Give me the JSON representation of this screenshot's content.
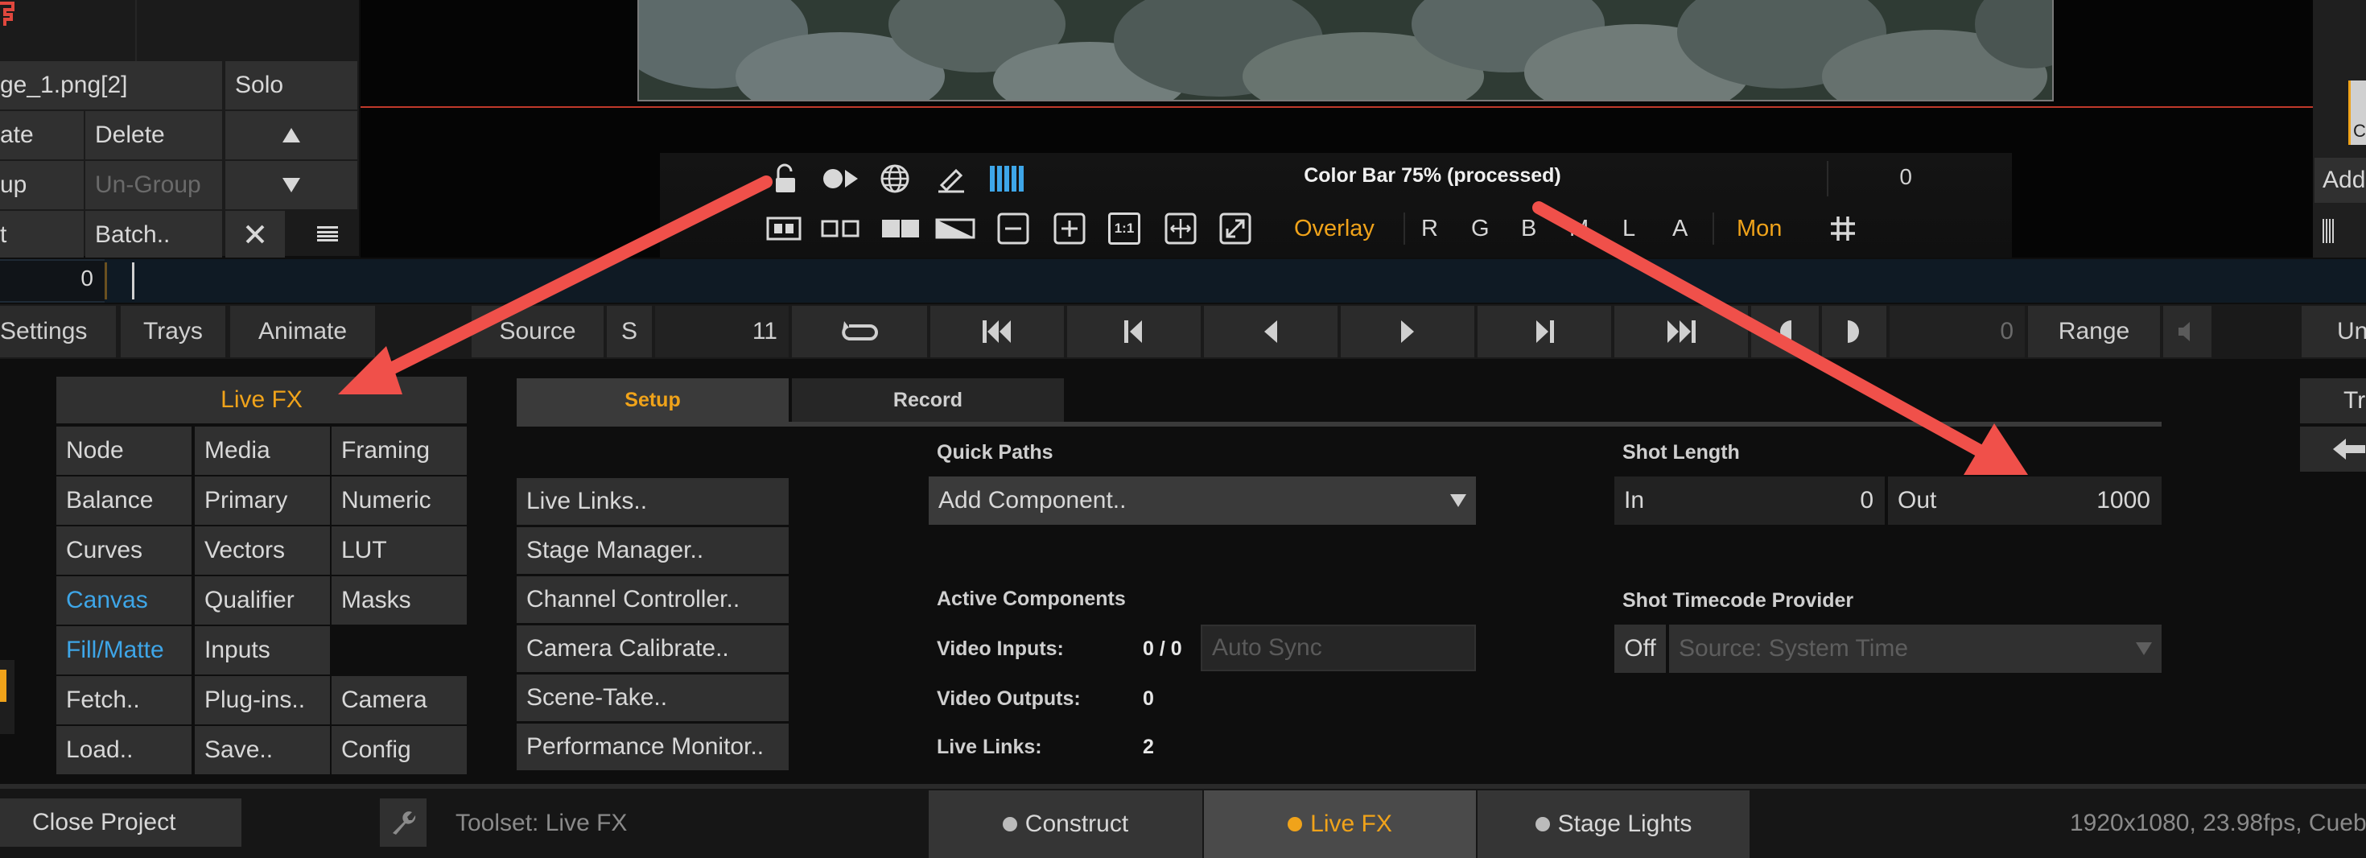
{
  "layer_panel": {
    "layer_name": "ge_1.png[2]",
    "solo_label": "Solo",
    "duplicate_label": "ate",
    "delete_label": "Delete",
    "group_label": "up",
    "ungroup_label": "Un-Group",
    "edit_label": "t",
    "batch_label": "Batch.."
  },
  "viewer_toolbar": {
    "status_text": "Color Bar 75% (processed)",
    "frame_value": "0",
    "overlay_label": "Overlay",
    "channels": [
      "R",
      "G",
      "B",
      "M",
      "L",
      "A"
    ],
    "mon_label": "Mon",
    "one_to_one_label": "1:1"
  },
  "timeline": {
    "frame_value": "0"
  },
  "transport": {
    "settings_label": "Settings",
    "trays_label": "Trays",
    "animate_label": "Animate",
    "source_label": "Source",
    "s_label": "S",
    "frame_count": "11",
    "current_frame": "0",
    "range_label": "Range",
    "right_label": "Un"
  },
  "toolset_menu": {
    "header": "Live FX",
    "items": [
      [
        "Node",
        "Media",
        "Framing"
      ],
      [
        "Balance",
        "Primary",
        "Numeric"
      ],
      [
        "Curves",
        "Vectors",
        "LUT"
      ],
      [
        "Canvas",
        "Qualifier",
        "Masks"
      ],
      [
        "Fill/Matte",
        "Inputs",
        ""
      ],
      [
        "Fetch..",
        "Plug-ins..",
        "Camera"
      ],
      [
        "Load..",
        "Save..",
        "Config"
      ]
    ]
  },
  "livefx_panel": {
    "tabs": [
      "Setup",
      "Record"
    ],
    "menu_items": [
      "Live Links..",
      "Stage Manager..",
      "Channel Controller..",
      "Camera Calibrate..",
      "Scene-Take..",
      "Performance Monitor.."
    ],
    "quick_paths_label": "Quick Paths",
    "add_component_label": "Add Component..",
    "active_components_label": "Active Components",
    "video_inputs_label": "Video Inputs:",
    "video_inputs_value": "0 / 0",
    "auto_sync_placeholder": "Auto Sync",
    "video_outputs_label": "Video Outputs:",
    "video_outputs_value": "0",
    "live_links_label": "Live Links:",
    "live_links_value": "2",
    "shot_length_label": "Shot Length",
    "in_label": "In",
    "in_value": "0",
    "out_label": "Out",
    "out_value": "1000",
    "timecode_provider_label": "Shot Timecode Provider",
    "off_label": "Off",
    "source_value": "Source: System Time"
  },
  "right_panel": {
    "add_label": "Add",
    "tr_label": "Tr",
    "c_label": "C"
  },
  "status_bar": {
    "close_project_label": "Close Project",
    "toolset_text": "Toolset: Live FX",
    "modes": [
      "Construct",
      "Live FX",
      "Stage Lights"
    ],
    "info_text": "1920x1080, 23.98fps, Cueb"
  },
  "colors": {
    "accent_orange": "#f0a31a",
    "link_blue": "#3ea6e8",
    "annotation_red": "#f0504a",
    "panel_bg": "#303030"
  }
}
